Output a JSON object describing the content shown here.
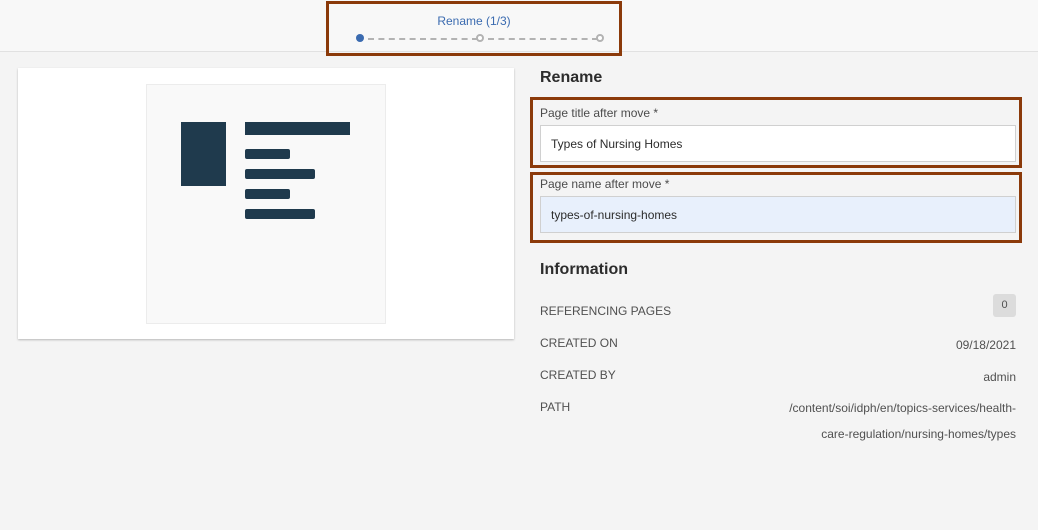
{
  "wizard": {
    "step_label": "Rename (1/3)"
  },
  "form": {
    "section_title": "Rename",
    "page_title_label": "Page title after move *",
    "page_title_value": "Types of Nursing Homes",
    "page_name_label": "Page name after move *",
    "page_name_value": "types-of-nursing-homes"
  },
  "information": {
    "section_title": "Information",
    "referencing_pages_label": "REFERENCING PAGES",
    "referencing_pages_count": "0",
    "created_on_label": "CREATED ON",
    "created_on_value": "09/18/2021",
    "created_by_label": "CREATED BY",
    "created_by_value": "admin",
    "path_label": "PATH",
    "path_line1": "/content/soi/idph/en/topics-services/health-",
    "path_line2": "care-regulation/nursing-homes/types"
  },
  "colors": {
    "highlight_border": "#8b3a0a",
    "active_step": "#3b6bb0",
    "thumbnail_blocks": "#1f3a4d"
  }
}
